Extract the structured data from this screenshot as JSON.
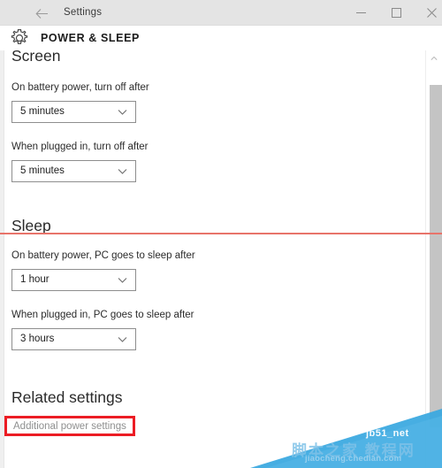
{
  "window": {
    "title": "Settings",
    "back_icon": "back-arrow-icon",
    "controls": {
      "minimize_label": "Minimize",
      "maximize_label": "Maximize",
      "close_label": "Close"
    }
  },
  "header": {
    "icon": "gear-icon",
    "title": "POWER & SLEEP"
  },
  "sections": [
    {
      "id": "screen",
      "heading": "Screen",
      "fields": [
        {
          "label": "On battery power, turn off after",
          "value": "5 minutes",
          "chevron": "chevron-down-icon"
        },
        {
          "label": "When plugged in, turn off after",
          "value": "5 minutes",
          "chevron": "chevron-down-icon"
        }
      ]
    },
    {
      "id": "sleep",
      "heading": "Sleep",
      "fields": [
        {
          "label": "On battery power, PC goes to sleep after",
          "value": "1 hour",
          "chevron": "chevron-down-icon"
        },
        {
          "label": "When plugged in, PC goes to sleep after",
          "value": "3 hours",
          "chevron": "chevron-down-icon"
        }
      ]
    },
    {
      "id": "related",
      "heading": "Related settings",
      "link": "Additional power settings"
    }
  ],
  "scrollbar": {
    "up_arrow": "scroll-up-arrow-icon"
  },
  "annotations": {
    "line_color": "#e8736a",
    "box_color": "#ec1c24"
  },
  "watermark": {
    "site": "jb51_net",
    "chinese": "脚本之家 教程网",
    "url": "jiaocheng.chedian.com"
  }
}
